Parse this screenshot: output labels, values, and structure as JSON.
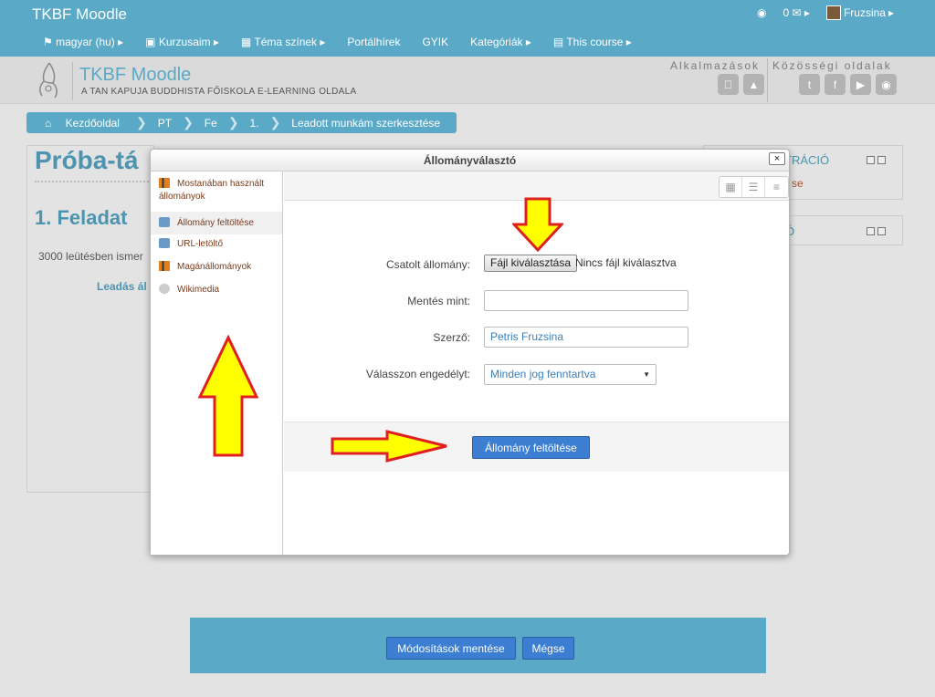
{
  "topbar": {
    "brand": "TKBF Moodle",
    "messages_count": "0",
    "user_name": "Fruzsina",
    "nav": [
      {
        "label": "magyar (hu)",
        "icon": "flag-icon",
        "caret": true
      },
      {
        "label": "Kurzusaim",
        "icon": "briefcase-icon",
        "caret": true
      },
      {
        "label": "Téma színek",
        "icon": "grid-icon",
        "caret": true
      },
      {
        "label": "Portálhírek",
        "icon": "",
        "caret": false
      },
      {
        "label": "GYIK",
        "icon": "",
        "caret": false
      },
      {
        "label": "Kategóriák",
        "icon": "",
        "caret": true
      },
      {
        "label": "This course",
        "icon": "book-icon",
        "caret": true
      }
    ]
  },
  "header": {
    "title": "TKBF Moodle",
    "subtitle": "A TAN KAPUJA BUDDHISTA FŐISKOLA E-LEARNING OLDALA",
    "apps_label": "Alkalmazások",
    "social_label": "Közösségi oldalak"
  },
  "breadcrumb": {
    "home": "Kezdőoldal",
    "items": [
      "PT",
      "Fe",
      "1.",
      "Leadott munkám szerkesztése"
    ]
  },
  "page": {
    "title": "Próba-tá",
    "heading": "1. Feladat",
    "text": "3000 leütésben ismer",
    "text2": "Leadás ál",
    "right_block_title": "TRÁCIÓ",
    "right_block_link": "se",
    "right_block2_title": "Ó"
  },
  "dialog": {
    "title": "Állományválasztó",
    "close": "×",
    "repositories": [
      {
        "label": "Mostanában használt állományok",
        "icon": "recent-files-icon"
      },
      {
        "label": "Állomány feltöltése",
        "icon": "upload-icon"
      },
      {
        "label": "URL-letöltő",
        "icon": "url-icon"
      },
      {
        "label": "Magánállományok",
        "icon": "private-files-icon"
      },
      {
        "label": "Wikimedia",
        "icon": "wikimedia-icon"
      }
    ],
    "form": {
      "attachment_label": "Csatolt állomány:",
      "choose_file_button": "Fájl kiválasztása",
      "no_file_text": "Nincs fájl kiválasztva",
      "save_as_label": "Mentés mint:",
      "save_as_value": "",
      "author_label": "Szerző:",
      "author_value": "Petris Fruzsina",
      "license_label": "Válasszon engedélyt:",
      "license_value": "Minden jog fenntartva",
      "upload_button": "Állomány feltöltése"
    }
  },
  "footer": {
    "save_button": "Módosítások mentése",
    "cancel_button": "Mégse"
  },
  "colors": {
    "accent": "#5aa9c6",
    "button_blue": "#3c7ed1",
    "arrow_fill": "#ffff00",
    "arrow_stroke": "#e02020"
  }
}
